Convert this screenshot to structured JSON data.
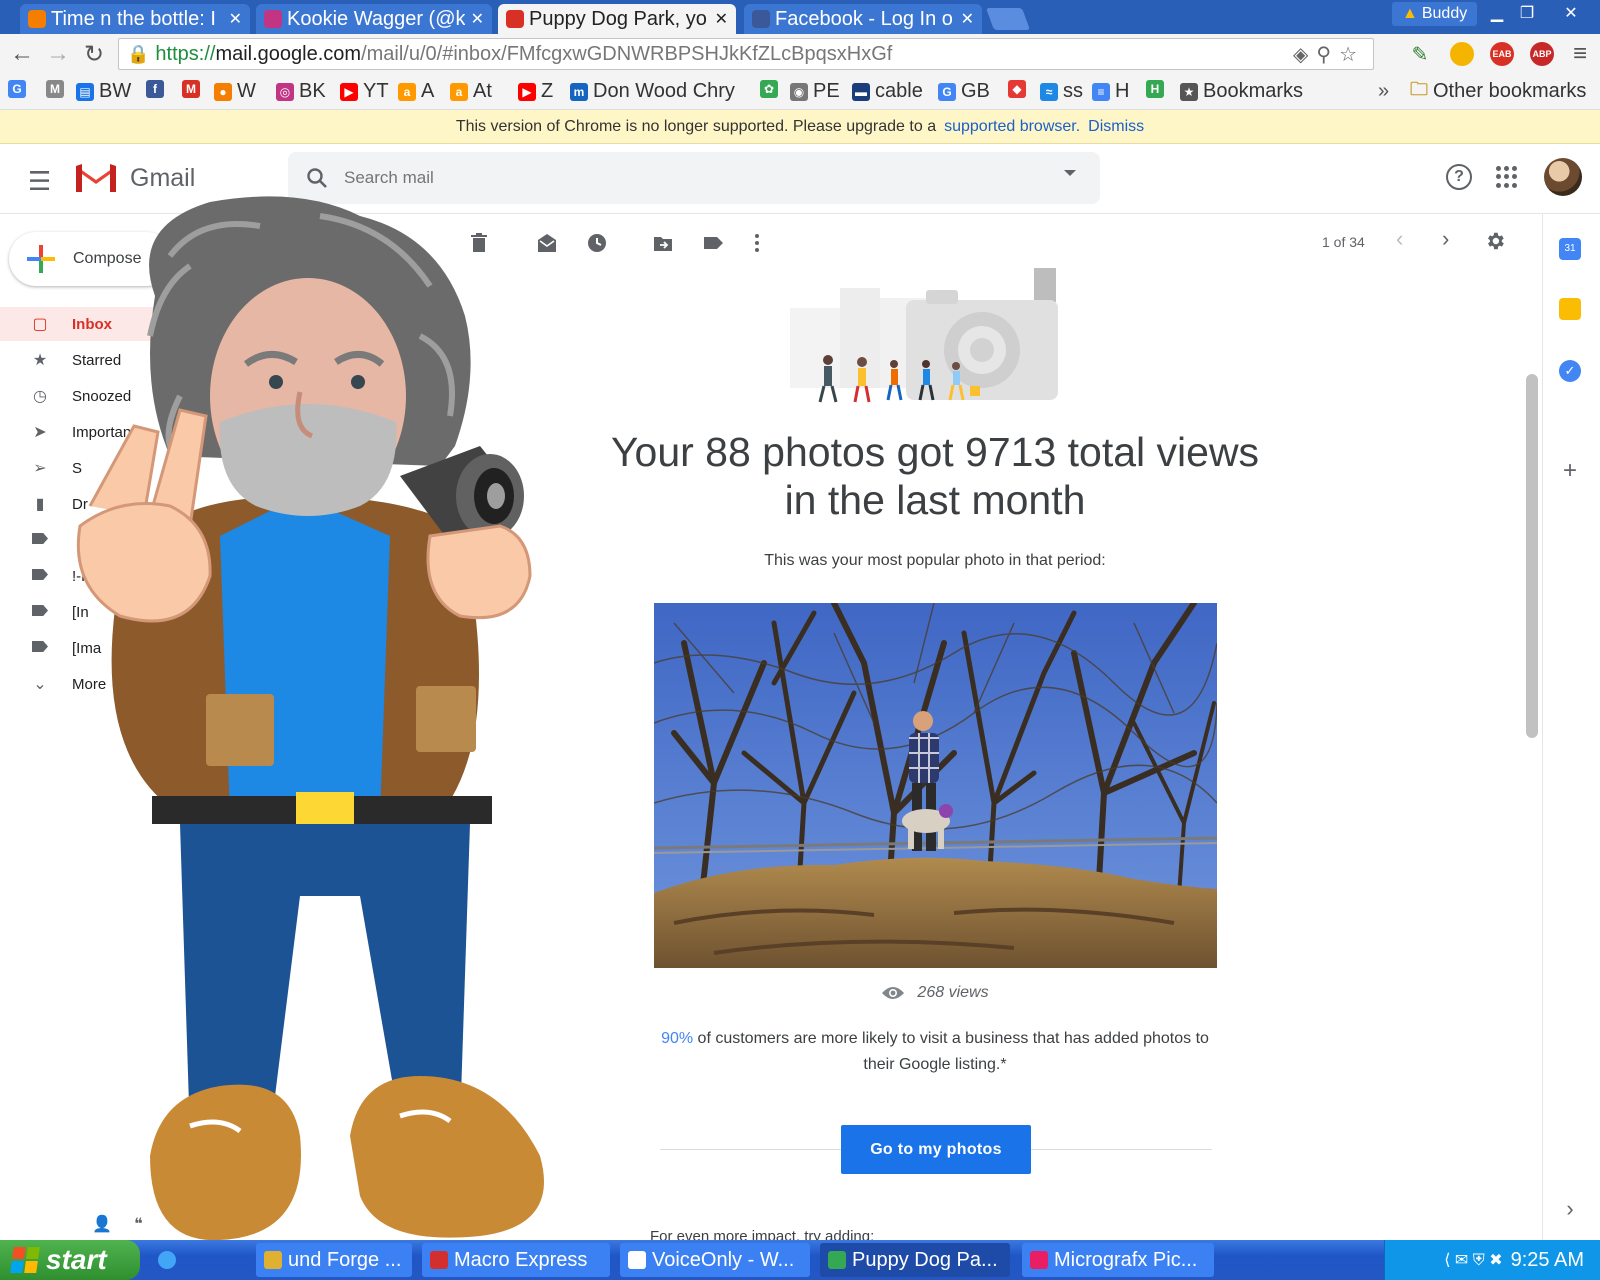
{
  "browser": {
    "tabs": [
      {
        "title": "Time n the bottle: I",
        "favicon_color": "#f57d00"
      },
      {
        "title": "Kookie Wagger (@k",
        "favicon_color": "#c13584"
      },
      {
        "title": "Puppy Dog Park, yo",
        "favicon_color": "#d93025",
        "active": true
      },
      {
        "title": "Facebook - Log In o",
        "favicon_color": "#3b5998"
      }
    ],
    "profile_name": "Buddy",
    "url": {
      "scheme": "https://",
      "host": "mail.google.com",
      "path": "/mail/u/0/#inbox/FMfcgxwGDNWRBPSHJkKfZLcBpqsxHxGf"
    },
    "extensions": [
      {
        "color": "#f4b400"
      },
      {
        "color": "#d93025",
        "label": "EAB"
      },
      {
        "color": "#c62828",
        "label": "ABP"
      }
    ],
    "bookmarks": [
      {
        "label": "",
        "color": "#4285f4",
        "glyph": "G"
      },
      {
        "label": "",
        "color": "#888888",
        "glyph": "M"
      },
      {
        "label": "BW",
        "color": "#1a73e8",
        "glyph": "▤"
      },
      {
        "label": "",
        "color": "#3b5998",
        "glyph": "f"
      },
      {
        "label": "",
        "color": "#d93025",
        "glyph": "M"
      },
      {
        "label": "W",
        "color": "#f57d00",
        "glyph": "●"
      },
      {
        "label": "BK",
        "color": "#c13584",
        "glyph": "◎"
      },
      {
        "label": "YT",
        "color": "#ff0000",
        "glyph": "▶"
      },
      {
        "label": "A",
        "color": "#ff9900",
        "glyph": "a"
      },
      {
        "label": "At",
        "color": "#ff9900",
        "glyph": "a"
      },
      {
        "label": "Z",
        "color": "#ff0000",
        "glyph": "▶"
      },
      {
        "label": "Don Wood Chry",
        "color": "#1565c0",
        "glyph": "m"
      },
      {
        "label": "",
        "color": "#34a853",
        "glyph": "✿"
      },
      {
        "label": "PE",
        "color": "#777777",
        "glyph": "◉"
      },
      {
        "label": "cable",
        "color": "#1a3d7c",
        "glyph": "▬"
      },
      {
        "label": "GB",
        "color": "#4285f4",
        "glyph": "G"
      },
      {
        "label": "",
        "color": "#e53935",
        "glyph": "◆"
      },
      {
        "label": "ss",
        "color": "#1e88e5",
        "glyph": "≈"
      },
      {
        "label": "H",
        "color": "#4285f4",
        "glyph": "≡"
      },
      {
        "label": "",
        "color": "#34a853",
        "glyph": "H"
      },
      {
        "label": "Bookmarks",
        "color": "#555555",
        "glyph": "★"
      }
    ],
    "overflow_glyph": "»",
    "other_bookmarks": "Other bookmarks",
    "infobar": {
      "message": "This version of Chrome is no longer supported. Please upgrade to a",
      "link": "supported browser.",
      "dismiss": "Dismiss"
    }
  },
  "gmail": {
    "brand": "Gmail",
    "search_placeholder": "Search mail",
    "compose_label": "Compose",
    "nav": [
      {
        "label": "Inbox",
        "icon": "inbox-icon",
        "active": true
      },
      {
        "label": "Starred",
        "icon": "star-icon"
      },
      {
        "label": "Snoozed",
        "icon": "clock-icon"
      },
      {
        "label": "Important",
        "icon": "important-icon"
      },
      {
        "label": "S",
        "icon": "sent-icon"
      },
      {
        "label": "Dr",
        "icon": "draft-icon"
      },
      {
        "label": "",
        "icon": "label-icon",
        "expandable": true
      },
      {
        "label": "!-K",
        "icon": "label-icon"
      },
      {
        "label": "[In",
        "icon": "label-icon"
      },
      {
        "label": "[Ima",
        "icon": "label-icon"
      },
      {
        "label": "More",
        "icon": "chevron-down-icon"
      }
    ],
    "pager": "1 of 34",
    "accent": "#1a73e8",
    "message": {
      "headline_line1": "Your 88 photos got 9713 total views",
      "headline_line2": "in the last month",
      "subline": "This was your most popular photo in that period:",
      "views": "268 views",
      "stat_percent": "90%",
      "stat_text": " of customers are more likely to visit a business that has added photos to their Google listing.*",
      "cta": "Go to my photos",
      "footer_lead": "For even more impact, try adding:"
    }
  },
  "taskbar": {
    "start_label": "start",
    "tasks": [
      {
        "title": "und Forge ...",
        "color": "#e0b030"
      },
      {
        "title": "Macro Express",
        "color": "#d32f2f"
      },
      {
        "title": "VoiceOnly - W...",
        "color": "#ffffff"
      },
      {
        "title": "Puppy Dog Pa...",
        "color": "#34a853",
        "active": true
      },
      {
        "title": "Micrografx Pic...",
        "color": "#e91e63"
      }
    ],
    "clock": "9:25 AM"
  }
}
